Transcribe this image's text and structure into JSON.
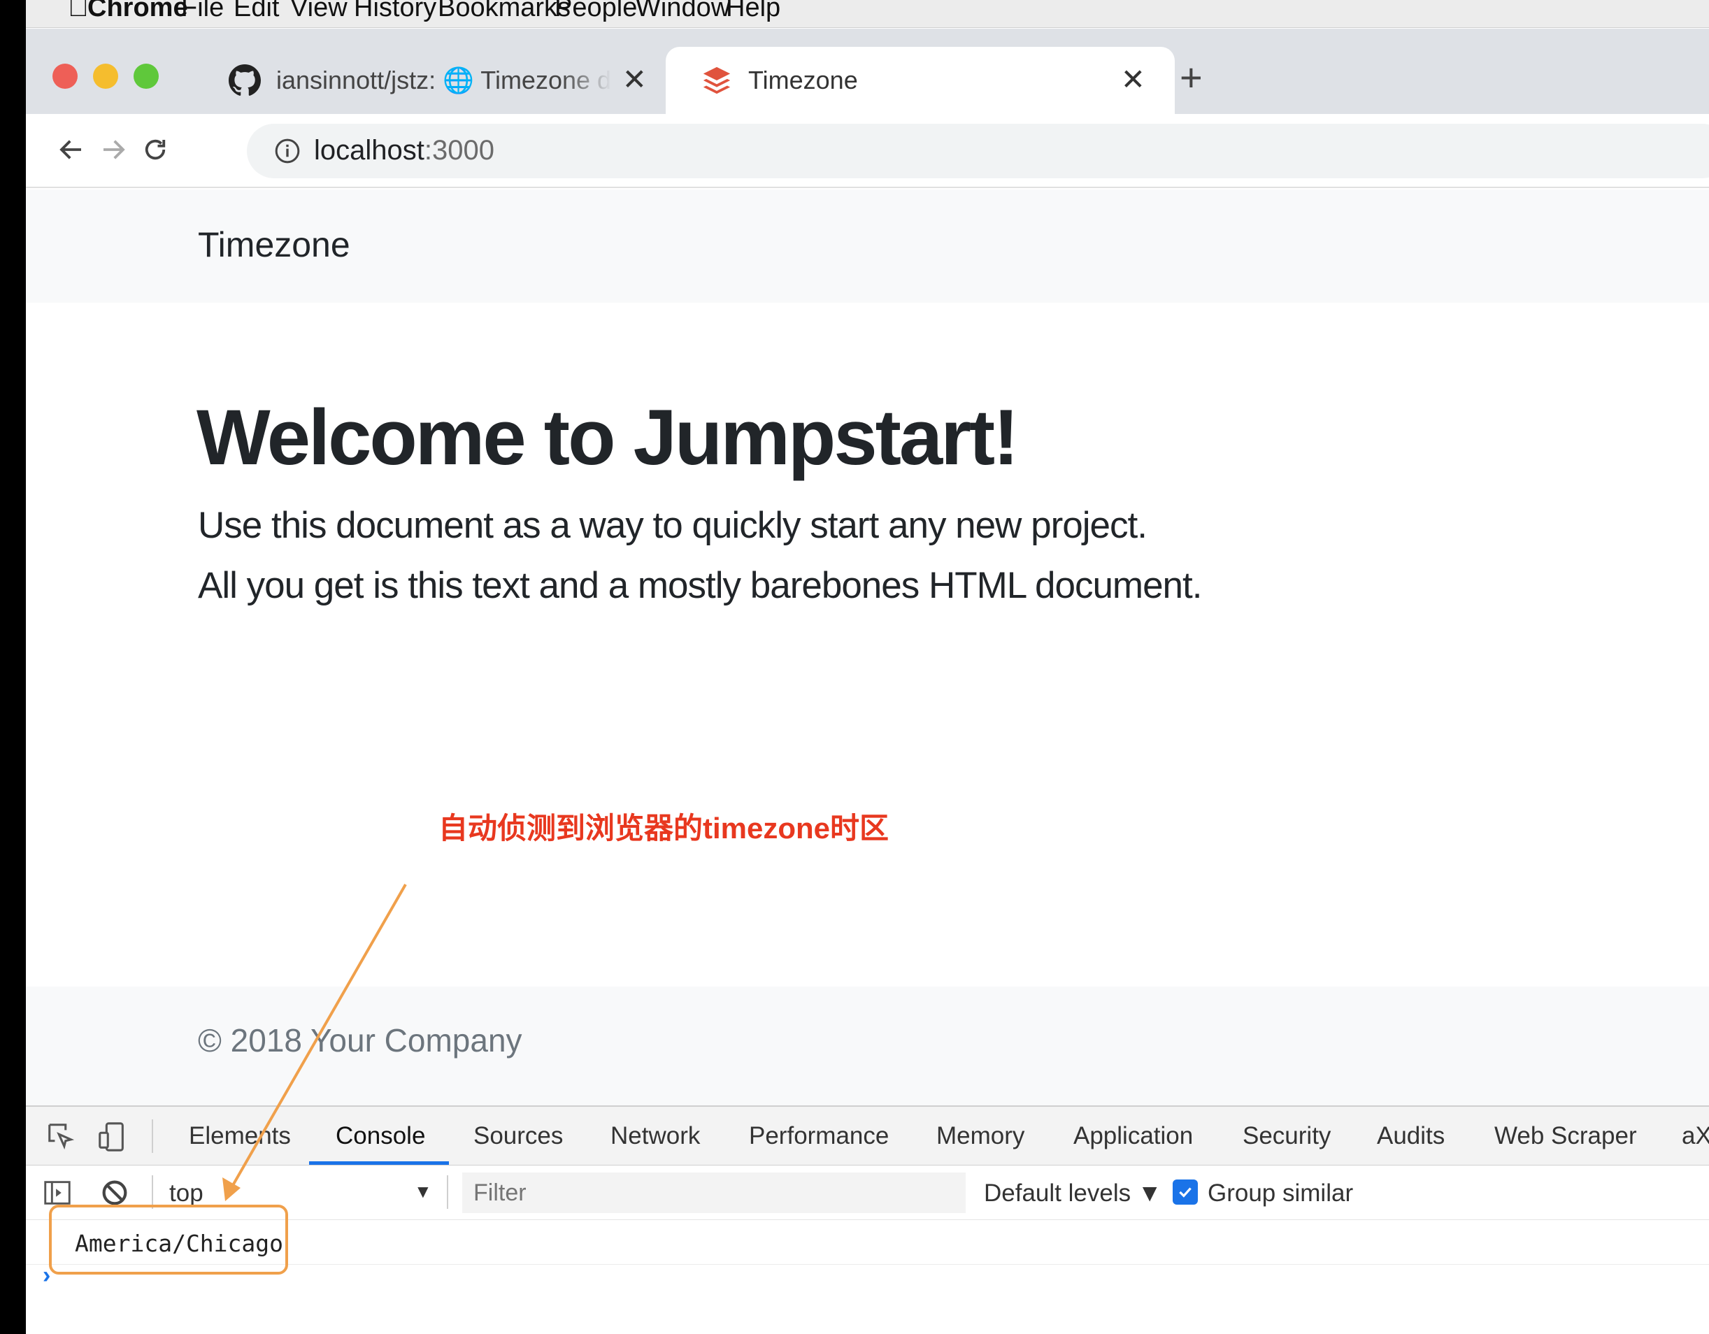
{
  "menubar": {
    "app_name": "Chrome",
    "items": [
      "File",
      "Edit",
      "View",
      "History",
      "Bookmarks",
      "People",
      "Window",
      "Help"
    ]
  },
  "tabs": [
    {
      "title": "iansinnott/jstz: 🌐 Timezone de",
      "icon": "github-icon",
      "active": false
    },
    {
      "title": "Timezone",
      "icon": "layers-icon",
      "active": true
    }
  ],
  "toolbar": {
    "host": "localhost",
    "port": ":3000"
  },
  "page": {
    "brand": "Timezone",
    "heading": "Welcome to Jumpstart!",
    "lead_lines": [
      "Use this document as a way to quickly start any new project.",
      "All you get is this text and a mostly barebones HTML document."
    ],
    "footer": "© 2018 Your Company"
  },
  "annotation": {
    "text": "自动侦测到浏览器的timezone时区",
    "color": "#e8381f",
    "arrow_color": "#f0a04b"
  },
  "devtools": {
    "tabs": [
      "Elements",
      "Console",
      "Sources",
      "Network",
      "Performance",
      "Memory",
      "Application",
      "Security",
      "Audits",
      "Web Scraper",
      "aX"
    ],
    "active_tab": "Console",
    "context": "top",
    "filter_placeholder": "Filter",
    "levels": "Default levels ▼",
    "group_similar": "Group similar",
    "log_output": "America/Chicago"
  },
  "colors": {
    "accent": "#1a73e8",
    "traffic_red": "#ee5f57",
    "traffic_yellow": "#f5bd2e",
    "traffic_green": "#5fc83b"
  }
}
